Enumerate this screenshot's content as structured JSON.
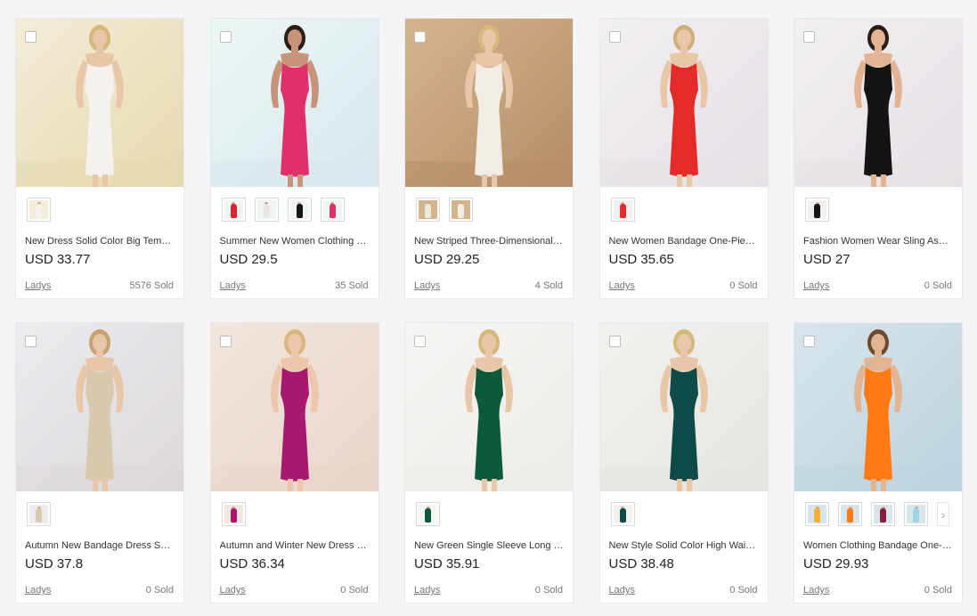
{
  "products": [
    {
      "title": "New Dress Solid Color Big Temperament Slim Fit Bandage Dress",
      "price": "USD 33.77",
      "shop": "Ladys",
      "sold": "5576 Sold",
      "bg": "#e6d9b0",
      "bg2": "#f3ecd8",
      "skin": "#e8c6a8",
      "hair": "#d8b77a",
      "dress": "#f4f2ee",
      "swatches": [
        "#f4f2ee"
      ]
    },
    {
      "title": "Summer New Women Clothing Off Shoulder Bandage Dress",
      "price": "USD 29.5",
      "shop": "Ladys",
      "sold": "35 Sold",
      "bg": "#d7e8ee",
      "bg2": "#eef5f4",
      "skin": "#c89479",
      "hair": "#2b1e18",
      "dress": "#e0306b",
      "swatches": [
        "#d9232e",
        "#e9e6e2",
        "#161616",
        "#e0306b"
      ]
    },
    {
      "title": "New Striped Three-Dimensional Mermaid Bandage Dress",
      "price": "USD 29.25",
      "shop": "Ladys",
      "sold": "4 Sold",
      "bg": "#b58d68",
      "bg2": "#d4b48f",
      "skin": "#e8c6a8",
      "hair": "#d8b77a",
      "dress": "#f1ede6",
      "swatches": [
        "#efe8dc",
        "#f1ede6"
      ]
    },
    {
      "title": "New Women Bandage One-Piece Strap Red Dress",
      "price": "USD 35.65",
      "shop": "Ladys",
      "sold": "0 Sold",
      "bg": "#e5e1e6",
      "bg2": "#f2eff2",
      "skin": "#e8c6a8",
      "hair": "#cfae7c",
      "dress": "#e52a2a",
      "swatches": [
        "#e52a2a"
      ]
    },
    {
      "title": "Fashion Women Wear Sling Asymmetric Black Dress",
      "price": "USD 27",
      "shop": "Ladys",
      "sold": "0 Sold",
      "bg": "#e5e1e6",
      "bg2": "#f2eff2",
      "skin": "#e3b494",
      "hair": "#2a1d19",
      "dress": "#141414",
      "swatches": [
        "#141414"
      ]
    },
    {
      "title": "Autumn New Bandage Dress Sequin Gold Dress",
      "price": "USD 37.8",
      "shop": "Ladys",
      "sold": "0 Sold",
      "bg": "#dcd8dc",
      "bg2": "#ecebee",
      "skin": "#e8c6a8",
      "hair": "#c6a172",
      "dress": "#d9c9ac",
      "swatches": [
        "#d9c9ac"
      ]
    },
    {
      "title": "Autumn and Winter New Dress Long Sleeve Bandage Dress",
      "price": "USD 36.34",
      "shop": "Ladys",
      "sold": "0 Sold",
      "bg": "#e8d5c9",
      "bg2": "#f2e6de",
      "skin": "#ecc6ad",
      "hair": "#d8b77a",
      "dress": "#a7186e",
      "swatches": [
        "#a7186e"
      ]
    },
    {
      "title": "New Green Single Sleeve Long Slit Bandage Dress",
      "price": "USD 35.91",
      "shop": "Ladys",
      "sold": "0 Sold",
      "bg": "#ecebe8",
      "bg2": "#f7f6f4",
      "skin": "#e8c6a8",
      "hair": "#d8b77a",
      "dress": "#0d5a3a",
      "swatches": [
        "#0d5a3a"
      ]
    },
    {
      "title": "New Style Solid Color High Waist Velvet Dress",
      "price": "USD 38.48",
      "shop": "Ladys",
      "sold": "0 Sold",
      "bg": "#e7e5e1",
      "bg2": "#f2f1ee",
      "skin": "#e8c6a8",
      "hair": "#d8b77a",
      "dress": "#0d4a48",
      "swatches": [
        "#0d4a48"
      ]
    },
    {
      "title": "Women Clothing Bandage One-Piece V-Neck Dress",
      "price": "USD 29.93",
      "shop": "Ladys",
      "sold": "0 Sold",
      "bg": "#bdd3de",
      "bg2": "#d7e5ec",
      "skin": "#e3b494",
      "hair": "#6e4b2e",
      "dress": "#ff7a12",
      "swatches": [
        "#f4b136",
        "#ff7a12",
        "#8b1c3c",
        "#9fd4e6"
      ],
      "has_more": true
    }
  ]
}
